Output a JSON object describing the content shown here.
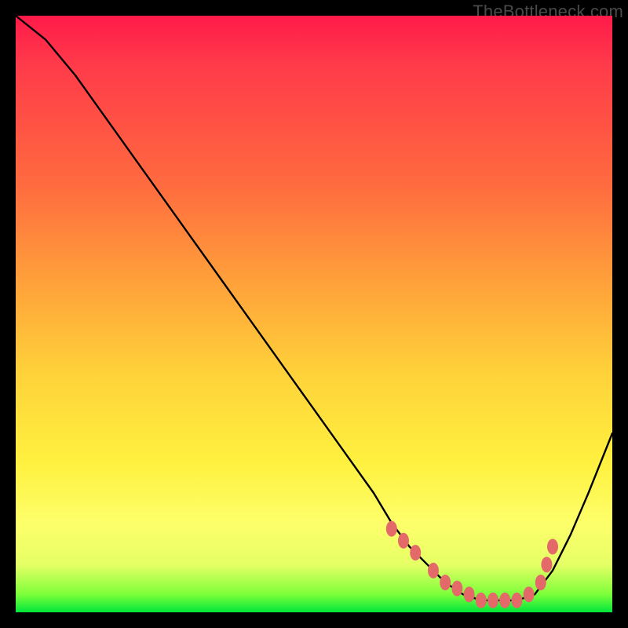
{
  "watermark": "TheBottleneck.com",
  "chart_data": {
    "type": "line",
    "title": "",
    "xlabel": "",
    "ylabel": "",
    "xlim": [
      0,
      100
    ],
    "ylim": [
      0,
      100
    ],
    "series": [
      {
        "name": "curve",
        "x": [
          0,
          5,
          10,
          15,
          20,
          25,
          30,
          35,
          40,
          45,
          50,
          55,
          60,
          63,
          66,
          69,
          72,
          75,
          78,
          81,
          84,
          87,
          90,
          93,
          96,
          100
        ],
        "y": [
          100,
          96,
          90,
          83,
          76,
          69,
          62,
          55,
          48,
          41,
          34,
          27,
          20,
          15,
          11,
          8,
          5,
          3,
          2,
          2,
          2,
          3,
          7,
          13,
          20,
          30
        ]
      }
    ],
    "markers": {
      "name": "highlight-dots",
      "color": "#e46a6a",
      "x": [
        63,
        65,
        67,
        70,
        72,
        74,
        76,
        78,
        80,
        82,
        84,
        86,
        88,
        89,
        90
      ],
      "y": [
        14,
        12,
        10,
        7,
        5,
        4,
        3,
        2,
        2,
        2,
        2,
        3,
        5,
        8,
        11
      ]
    }
  }
}
